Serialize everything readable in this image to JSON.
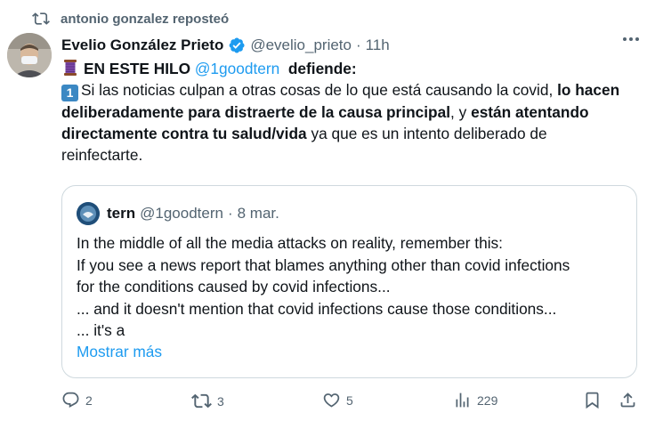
{
  "repost": {
    "label": "antonio gonzalez reposteó"
  },
  "tweet": {
    "author_name": "Evelio González Prieto",
    "handle": "@evelio_prieto",
    "separator": "·",
    "time": "11h",
    "line1_prefix": "EN ESTE HILO",
    "line1_mention": "@1goodtern",
    "line1_suffix": "defiende:",
    "num_emoji": "1",
    "p1": "Si las noticias culpan a otras cosas de lo que está causando la covid,",
    "p1_bold": "lo hacen deliberadamente para distraerte de la causa principal",
    "p2": ", y",
    "p2_bold": "están atentando directamente contra tu salud/vida",
    "p3": "ya que es un intento deliberado de reinfectarte."
  },
  "quote": {
    "author_name": "tern",
    "handle": "@1goodtern",
    "separator": "·",
    "date": "8 mar.",
    "lines": [
      "In the middle of all the media attacks on reality, remember this:",
      "If you see a news report that blames anything other than covid infections",
      "for the conditions caused by covid infections...",
      "... and it doesn't mention that covid infections cause those conditions...",
      "... it's a"
    ],
    "show_more": "Mostrar más"
  },
  "actions": {
    "replies": "2",
    "reposts": "3",
    "likes": "5",
    "views": "229"
  },
  "colors": {
    "accent": "#1d9bf0",
    "secondary_text": "#536471",
    "border": "#cfd9de"
  }
}
